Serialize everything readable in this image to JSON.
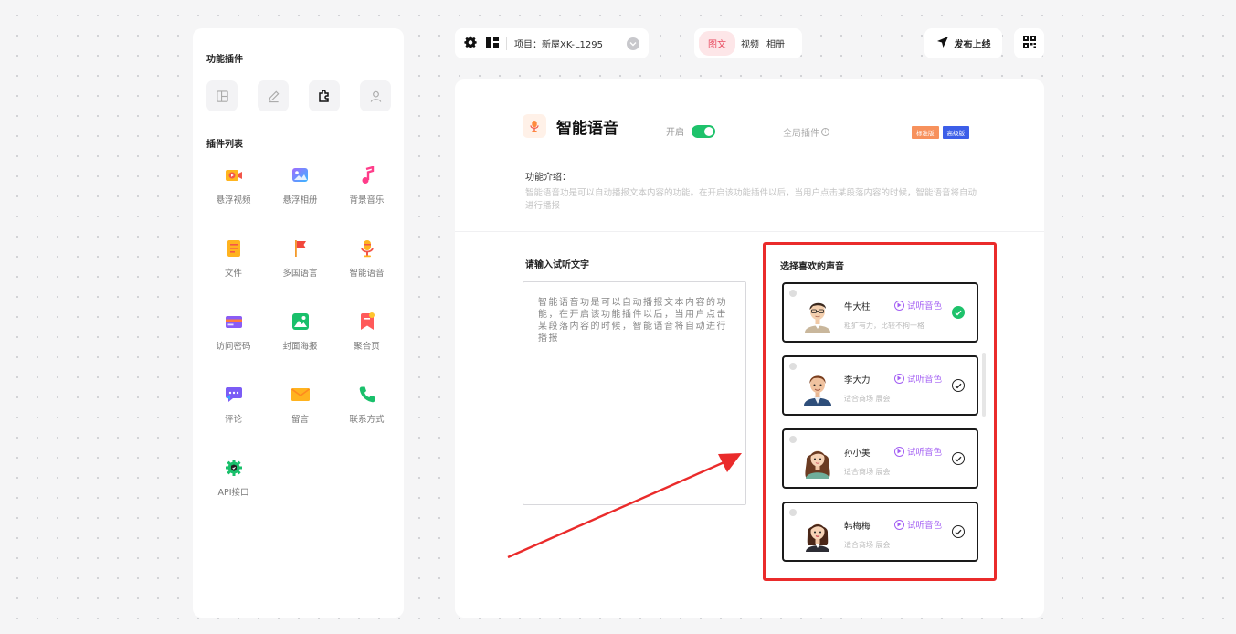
{
  "sidebar": {
    "function_plugins_title": "功能插件",
    "top_icons": [
      "layout-icon",
      "edit-icon",
      "puzzle-icon",
      "user-icon"
    ],
    "plugin_list_title": "插件列表",
    "plugins": [
      {
        "label": "悬浮视频",
        "icon": "video-icon"
      },
      {
        "label": "悬浮相册",
        "icon": "album-icon"
      },
      {
        "label": "背景音乐",
        "icon": "music-icon"
      },
      {
        "label": "文件",
        "icon": "file-icon"
      },
      {
        "label": "多国语言",
        "icon": "flag-icon"
      },
      {
        "label": "智能语音",
        "icon": "mic-icon"
      },
      {
        "label": "访问密码",
        "icon": "card-icon"
      },
      {
        "label": "封面海报",
        "icon": "poster-icon"
      },
      {
        "label": "聚合页",
        "icon": "bookmark-icon"
      },
      {
        "label": "评论",
        "icon": "chat-icon"
      },
      {
        "label": "留言",
        "icon": "mail-icon"
      },
      {
        "label": "联系方式",
        "icon": "phone-icon"
      },
      {
        "label": "API接口",
        "icon": "gear-shield-icon"
      }
    ]
  },
  "topbar": {
    "project_label": "项目：新屋XK-L1295",
    "mode_tabs": [
      "图文",
      "视频",
      "相册"
    ],
    "active_tab": "图文",
    "publish_label": "发布上线"
  },
  "feature": {
    "title": "智能语音",
    "switch_label": "开启",
    "switch_on": true,
    "global_label": "全局插件",
    "badges": [
      {
        "label": "标准版",
        "color": "#f7915c"
      },
      {
        "label": "高级版",
        "color": "#3c5ee8"
      }
    ],
    "intro_title": "功能介绍：",
    "intro_text": "智能语音功是可以自动播报文本内容的功能。在开启该功能插件以后，当用户点击某段落内容的时候，智能语音将自动进行播报"
  },
  "listen": {
    "title": "请输入试听文字",
    "text": "智能语音功是可以自动播报文本内容的功能，在开启该功能插件以后，当用户点击某段落内容的时候，智能语音将自动进行播报"
  },
  "voices": {
    "title": "选择喜欢的声音",
    "try_label": "试听音色",
    "items": [
      {
        "name": "牛大柱",
        "desc": "粗犷有力，比较不拘一格",
        "selected": true
      },
      {
        "name": "李大力",
        "desc": "适合商场 展会",
        "selected": false
      },
      {
        "name": "孙小美",
        "desc": "适合商场 展会",
        "selected": false
      },
      {
        "name": "韩梅梅",
        "desc": "适合商场 展会",
        "selected": false
      }
    ]
  },
  "colors": {
    "accent_green": "#1ec26b",
    "accent_purple": "#a35ff3",
    "highlight_red": "#ea2b2b",
    "tab_active_bg": "#fde6e8"
  }
}
